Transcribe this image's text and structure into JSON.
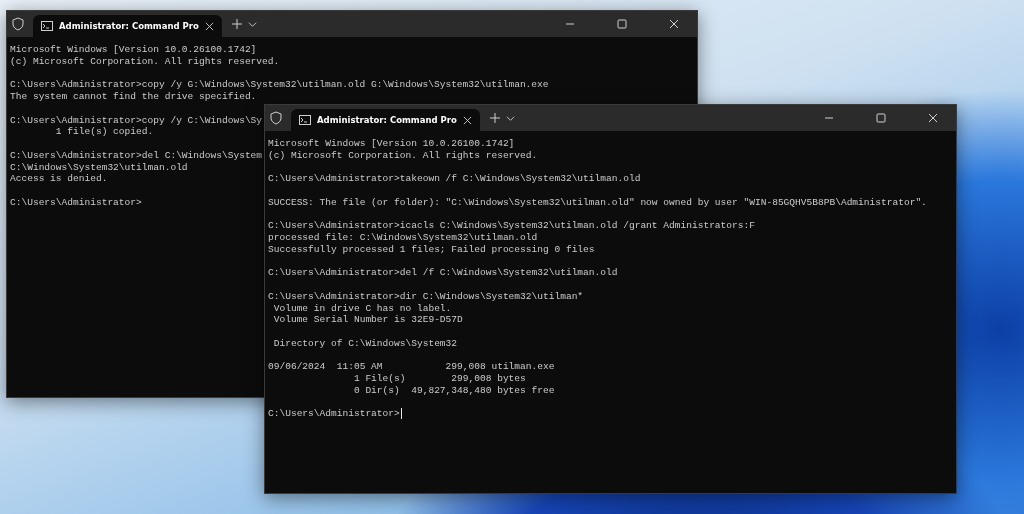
{
  "windows": [
    {
      "tab_title": "Administrator: Command Pro",
      "cursor": false,
      "blocks": [
        [
          "Microsoft Windows [Version 10.0.26100.1742]",
          "(c) Microsoft Corporation. All rights reserved."
        ],
        [
          "C:\\Users\\Administrator>copy /y G:\\Windows\\System32\\utilman.old G:\\Windows\\System32\\utilman.exe",
          "The system cannot find the drive specified."
        ],
        [
          "C:\\Users\\Administrator>copy /y C:\\Windows\\Sy",
          "        1 file(s) copied."
        ],
        [
          "C:\\Users\\Administrator>del C:\\Windows\\System",
          "C:\\Windows\\System32\\utilman.old",
          "Access is denied."
        ],
        [
          "C:\\Users\\Administrator>"
        ]
      ]
    },
    {
      "tab_title": "Administrator: Command Pro",
      "cursor": true,
      "blocks": [
        [
          "Microsoft Windows [Version 10.0.26100.1742]",
          "(c) Microsoft Corporation. All rights reserved."
        ],
        [
          "C:\\Users\\Administrator>takeown /f C:\\Windows\\System32\\utilman.old"
        ],
        [
          "SUCCESS: The file (or folder): \"C:\\Windows\\System32\\utilman.old\" now owned by user \"WIN-85GQHV5B8PB\\Administrator\"."
        ],
        [
          "C:\\Users\\Administrator>icacls C:\\Windows\\System32\\utilman.old /grant Administrators:F",
          "processed file: C:\\Windows\\System32\\utilman.old",
          "Successfully processed 1 files; Failed processing 0 files"
        ],
        [
          "C:\\Users\\Administrator>del /f C:\\Windows\\System32\\utilman.old"
        ],
        [
          "C:\\Users\\Administrator>dir C:\\Windows\\System32\\utilman*",
          " Volume in drive C has no label.",
          " Volume Serial Number is 32E9-D57D"
        ],
        [
          " Directory of C:\\Windows\\System32"
        ],
        [
          "09/06/2024  11:05 AM           299,008 utilman.exe",
          "               1 File(s)        299,008 bytes",
          "               0 Dir(s)  49,827,348,480 bytes free"
        ],
        [
          "C:\\Users\\Administrator>"
        ]
      ]
    }
  ]
}
